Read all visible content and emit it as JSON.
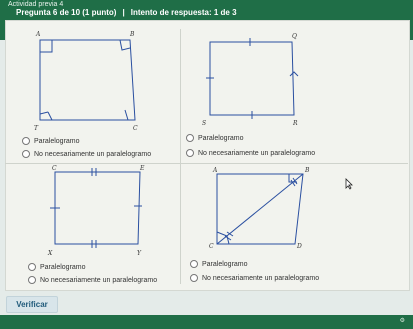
{
  "header": {
    "activity_title": "Actividad previa 4",
    "question_number": "Pregunta 6 de 10 (1 punto)",
    "separator": "|",
    "attempt": "Intento de respuesta: 1 de 3"
  },
  "figures": [
    {
      "vertices": [
        "A",
        "B",
        "C",
        "T"
      ]
    },
    {
      "vertices": [
        "Q",
        "R",
        "S"
      ]
    },
    {
      "vertices": [
        "C",
        "E",
        "Y",
        "X"
      ]
    },
    {
      "vertices": [
        "A",
        "B",
        "C",
        "D"
      ]
    }
  ],
  "options": [
    {
      "first": "Paralelogramo",
      "second": "No necesariamente un paralelogramo"
    },
    {
      "first": "Paralelogramo",
      "second": "No necesariamente un paralelogramo"
    },
    {
      "first": "Paralelogramo",
      "second": "No necesariamente un paralelogramo"
    },
    {
      "first": "Paralelogramo",
      "second": "No necesariamente un paralelogramo"
    }
  ],
  "actions": {
    "verify_label": "Verificar"
  },
  "icons": {
    "footer": "gear-icon",
    "pointer": "mouse-pointer-icon"
  },
  "colors": {
    "header_bg": "#1f6e47",
    "panel_bg": "#f2f3ee",
    "accent": "#1f5a7a",
    "figure_blue": "#2a4fa0"
  }
}
